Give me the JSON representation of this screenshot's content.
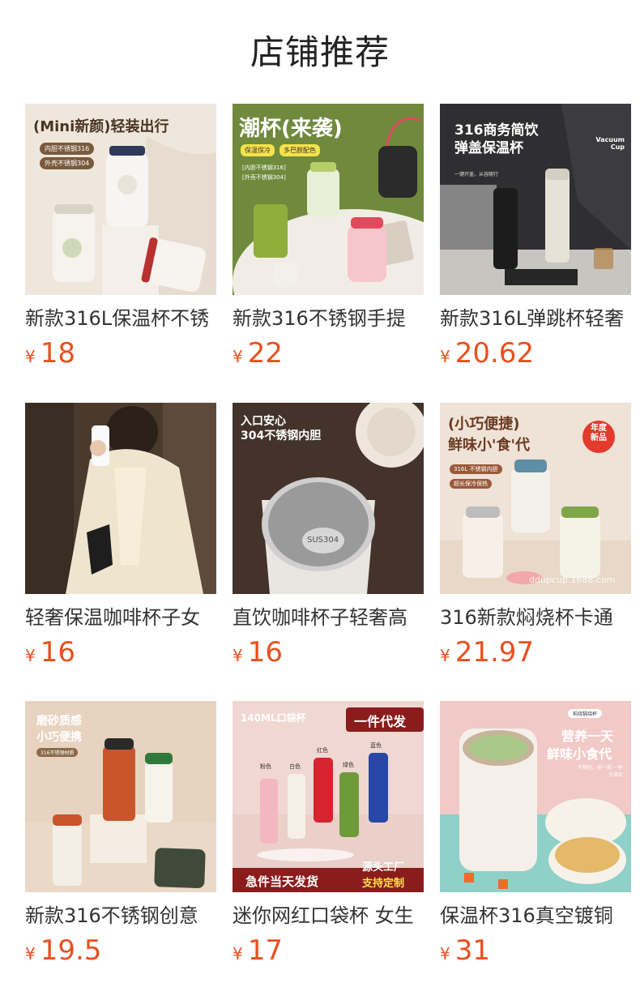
{
  "header": {
    "title": "店铺推荐"
  },
  "currency_symbol": "¥",
  "products": [
    {
      "name": "新款316L保温杯不锈",
      "price": "18",
      "image_text": {
        "headline": "(Mini新颜)轻装出行",
        "tags": [
          "内胆不锈钢316",
          "外壳不锈钢304"
        ]
      }
    },
    {
      "name": "新款316不锈钢手提",
      "price": "22",
      "image_text": {
        "headline": "潮杯(来袭)",
        "tags": [
          "保温保冷",
          "多巴胺配色"
        ],
        "notes": [
          "[内胆不锈钢316]",
          "[外壳不锈钢304]"
        ]
      }
    },
    {
      "name": "新款316L弹跳杯轻奢",
      "price": "20.62",
      "image_text": {
        "line1": "316商务简饮",
        "line2": "弹盖保温杯",
        "badge": "Vacuum Cup",
        "note": "一键开盖，从容随行"
      }
    },
    {
      "name": "轻奢保温咖啡杯子女",
      "price": "16",
      "image_text": {}
    },
    {
      "name": "直饮咖啡杯子轻奢高",
      "price": "16",
      "image_text": {
        "line1": "入口安心",
        "line2": "304不锈钢内胆",
        "engraving": "SUS304"
      }
    },
    {
      "name": "316新款焖烧杯卡通",
      "price": "21.97",
      "image_text": {
        "line1": "(小巧便捷)",
        "line2": "鲜味小'食'代",
        "badge": "年度新品",
        "tags": [
          "316L 不锈钢内胆",
          "超长保冷保热"
        ],
        "watermark": "ddupcup.1688.com"
      }
    },
    {
      "name": "新款316不锈钢创意",
      "price": "19.5",
      "image_text": {
        "line1": "磨砂质感",
        "line2": "小巧便携",
        "tag": "316不锈钢材质"
      }
    },
    {
      "name": "迷你网红口袋杯 女生",
      "price": "17",
      "image_text": {
        "line1": "140ML口袋杯",
        "badge": "一件代发",
        "footer_left": "急件当天发货",
        "footer_right1": "源头工厂",
        "footer_right2": "支持定制",
        "colors": [
          "粉色",
          "白色",
          "红色",
          "绿色",
          "蓝色"
        ]
      }
    },
    {
      "name": "保温杯316真空镀铜",
      "price": "31",
      "image_text": {
        "tag": "焖烧锅烧杯",
        "line1": "营养一天",
        "line2": "鲜味小食代",
        "note": "不糊也，焖一焖 一杯大满足"
      }
    }
  ]
}
